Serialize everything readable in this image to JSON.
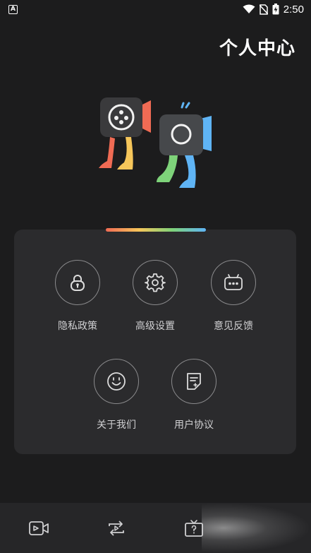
{
  "status_bar": {
    "app_indicator": "A",
    "icons": [
      "wifi-icon",
      "no-sim-icon",
      "battery-charging-icon"
    ],
    "time": "2:50"
  },
  "header": {
    "title": "个人中心"
  },
  "menu": {
    "items": [
      {
        "label": "隐私政策",
        "icon": "lock-icon"
      },
      {
        "label": "高级设置",
        "icon": "gear-icon"
      },
      {
        "label": "意见反馈",
        "icon": "feedback-icon"
      },
      {
        "label": "关于我们",
        "icon": "smile-icon"
      },
      {
        "label": "用户协议",
        "icon": "agreement-icon"
      }
    ]
  },
  "bottom_nav": {
    "items": [
      {
        "icon": "video-camera-icon"
      },
      {
        "icon": "repeat-play-icon"
      },
      {
        "icon": "tv-help-icon",
        "active": true
      }
    ]
  },
  "colors": {
    "background": "#1c1c1d",
    "panel": "#2b2b2d",
    "accent_red": "#f06b54",
    "accent_yellow": "#f6c65a",
    "accent_green": "#7ed37a",
    "accent_blue": "#5fb4f5"
  }
}
